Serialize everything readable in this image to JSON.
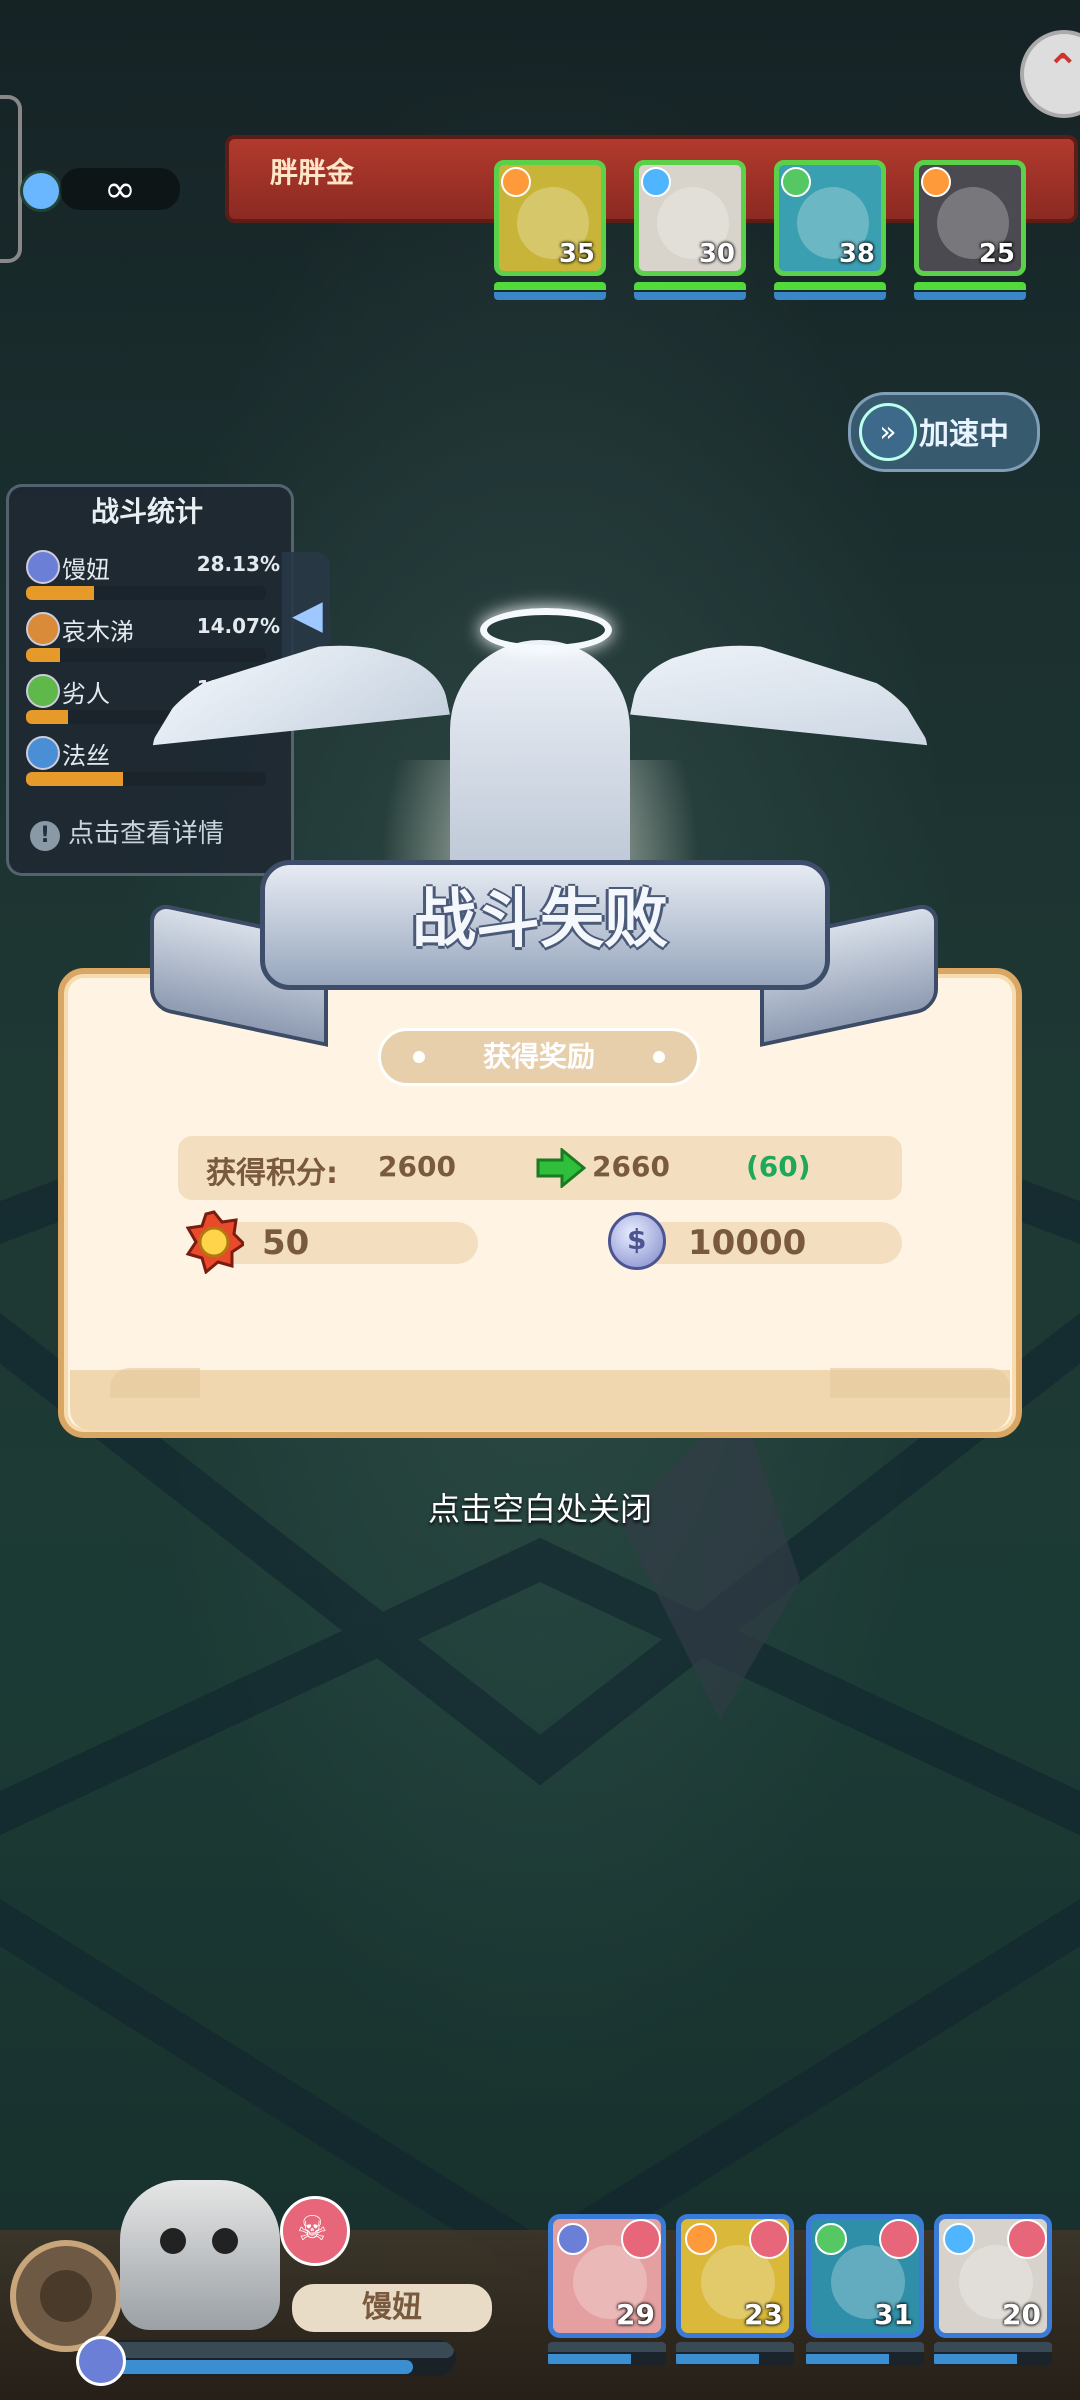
{
  "enemy": {
    "name": "胖胖金",
    "units": [
      {
        "level": "35",
        "hp": 100,
        "energy": 100,
        "color": "#c9b43a",
        "elem": "#ff9a3a"
      },
      {
        "level": "30",
        "hp": 100,
        "energy": 100,
        "color": "#d8d4cc",
        "elem": "#4fb5ff"
      },
      {
        "level": "38",
        "hp": 100,
        "energy": 100,
        "color": "#3a9fb0",
        "elem": "#55c864"
      },
      {
        "level": "25",
        "hp": 100,
        "energy": 100,
        "color": "#4a4a50",
        "elem": "#ff9a3a"
      }
    ]
  },
  "timer": {
    "value": "∞"
  },
  "speed_button": {
    "label": "加速中"
  },
  "battle_stats": {
    "title": "战斗统计",
    "rows": [
      {
        "name": "馒妞",
        "percent": "28.13%",
        "fill": 28.13
      },
      {
        "name": "哀木涕",
        "percent": "14.07%",
        "fill": 14.07
      },
      {
        "name": "劣人",
        "percent": "17.39%",
        "fill": 17.39
      },
      {
        "name": "法丝",
        "percent": "",
        "fill": 40.41
      }
    ],
    "detail_label": "点击查看详情"
  },
  "result": {
    "title": "战斗失败",
    "reward_tag": "获得奖励",
    "score_label": "获得积分:",
    "score_old": "2600",
    "score_new": "2660",
    "score_diff": "(60)",
    "medal_value": "50",
    "coin_value": "10000"
  },
  "close_hint": "点击空白处关闭",
  "player": {
    "hero_name": "馒妞",
    "hp": 88,
    "allies": [
      {
        "level": "29",
        "color": "#e4a0a0",
        "elem": "#6b7fd6"
      },
      {
        "level": "23",
        "color": "#d9b83a",
        "elem": "#ff9a3a"
      },
      {
        "level": "31",
        "color": "#2f8fa8",
        "elem": "#55c864"
      },
      {
        "level": "20",
        "color": "#d7d3cc",
        "elem": "#4fb5ff"
      }
    ]
  },
  "colors": {
    "accent_green": "#1fa85a",
    "panel": "#fff4e3",
    "banner": "#97a6bd"
  }
}
